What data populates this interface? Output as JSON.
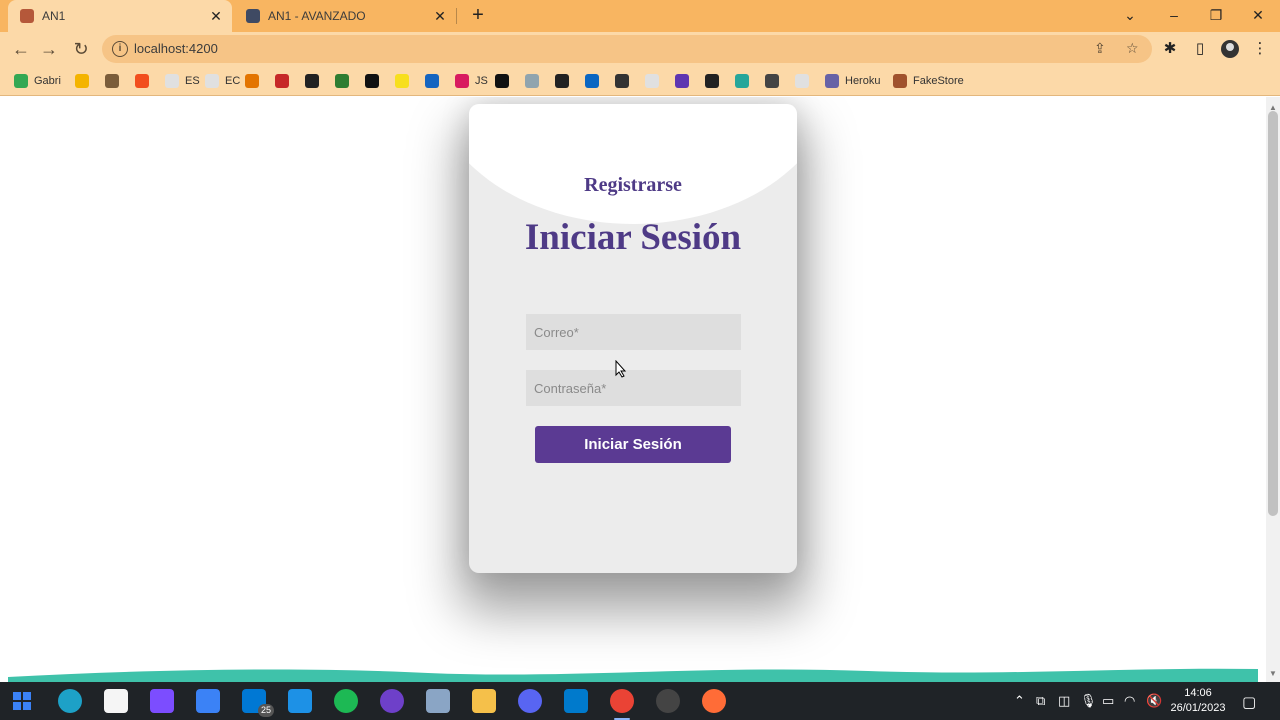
{
  "browser": {
    "tabs": [
      {
        "title": "AN1",
        "active": true
      },
      {
        "title": "AN1 - AVANZADO",
        "active": false
      }
    ],
    "new_tab_symbol": "+",
    "window_controls": {
      "minimize": "–",
      "restore": "❐",
      "close": "✕"
    },
    "url": "localhost:4200",
    "bookmarks": [
      {
        "label": "Gabri",
        "color": "#34a853"
      },
      {
        "label": "",
        "color": "#f4b400"
      },
      {
        "label": "",
        "color": "#7b5d3a"
      },
      {
        "label": "",
        "color": "#f24e1e"
      },
      {
        "label": "ES",
        "color": "#e0e0e0"
      },
      {
        "label": "EC",
        "color": "#e0e0e0"
      },
      {
        "label": "",
        "color": "#e37400"
      },
      {
        "label": "",
        "color": "#c62828"
      },
      {
        "label": "",
        "color": "#222222"
      },
      {
        "label": "",
        "color": "#2e7d32"
      },
      {
        "label": "",
        "color": "#111111"
      },
      {
        "label": "",
        "color": "#f7df1e"
      },
      {
        "label": "",
        "color": "#1565c0"
      },
      {
        "label": "JS",
        "color": "#d81b60"
      },
      {
        "label": "",
        "color": "#111111"
      },
      {
        "label": "",
        "color": "#90a4ae"
      },
      {
        "label": "",
        "color": "#222222"
      },
      {
        "label": "",
        "color": "#0a66c2"
      },
      {
        "label": "",
        "color": "#333333"
      },
      {
        "label": "",
        "color": "#e0e0e0"
      },
      {
        "label": "",
        "color": "#5e35b1"
      },
      {
        "label": "",
        "color": "#222222"
      },
      {
        "label": "",
        "color": "#26a69a"
      },
      {
        "label": "",
        "color": "#444444"
      },
      {
        "label": "",
        "color": "#e0e0e0"
      },
      {
        "label": "Heroku",
        "color": "#6762a6"
      },
      {
        "label": "FakeStore",
        "color": "#a0522d"
      }
    ]
  },
  "login": {
    "register_link": "Registrarse",
    "title": "Iniciar Sesión",
    "email_placeholder": "Correo*",
    "password_placeholder": "Contraseña*",
    "submit_label": "Iniciar Sesión",
    "accent_color": "#5b3a93"
  },
  "taskbar": {
    "apps": [
      {
        "name": "start",
        "color": "#3b82f6"
      },
      {
        "name": "edge",
        "color": "#1da1c7"
      },
      {
        "name": "file",
        "color": "#f5f5f5"
      },
      {
        "name": "visual-studio",
        "color": "#7c4dff"
      },
      {
        "name": "store",
        "color": "#3b82f6"
      },
      {
        "name": "mail",
        "color": "#0078d4"
      },
      {
        "name": "docker",
        "color": "#1d91e6"
      },
      {
        "name": "spotify",
        "color": "#1db954"
      },
      {
        "name": "github",
        "color": "#6e40c9"
      },
      {
        "name": "virtualbox",
        "color": "#8aa5c5"
      },
      {
        "name": "explorer",
        "color": "#f5c04a"
      },
      {
        "name": "discord",
        "color": "#5865f2"
      },
      {
        "name": "vscode",
        "color": "#007acc"
      },
      {
        "name": "chrome",
        "color": "#ea4335"
      },
      {
        "name": "obs",
        "color": "#444444"
      },
      {
        "name": "postman",
        "color": "#ff6c37"
      }
    ],
    "mail_badge": "25",
    "time": "14:06",
    "date": "26/01/2023"
  }
}
